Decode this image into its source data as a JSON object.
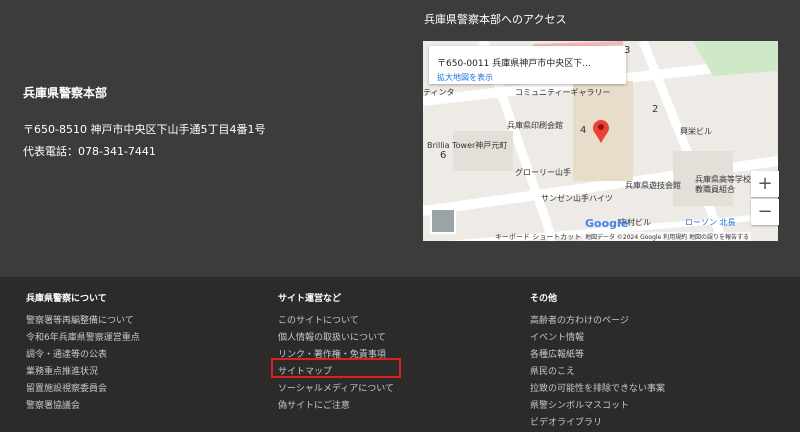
{
  "org": {
    "name": "兵庫県警察本部",
    "address": "〒650-8510 神戸市中央区下山手通5丁目4番1号",
    "tel": "代表電話：078-341-7441"
  },
  "access": {
    "title": "兵庫県警察本部へのアクセス",
    "map_card_address": "〒650-0011 兵庫県神戸市中央区下...",
    "map_card_link": "拡大地図を表示",
    "labels": [
      "コミュニティーギャラリー",
      "兵庫県印刷会館",
      "Brillia Tower神戸元町",
      "グローリー山手",
      "サンゼン山手ハイツ",
      "兵庫県遊技会館",
      "兵庫県高等学校",
      "教職員組合",
      "興栄ビル",
      "中村ビル",
      "ローソン 北長",
      "キーボード ショートカット",
      "ティンタ"
    ],
    "numbers": [
      "4",
      "2",
      "6",
      "3"
    ],
    "zoom_in": "+",
    "zoom_out": "−",
    "footer_attr": "地図データ ©2024 Google   利用規約   地図の誤りを報告する",
    "google": "Google"
  },
  "footer": {
    "col1": {
      "title": "兵庫県警察について",
      "links": [
        "警察署等再編整備について",
        "令和6年兵庫県警察運営重点",
        "調令・通達等の公表",
        "業務重点推進状況",
        "留置施設視察委員会",
        "警察署協議会"
      ]
    },
    "col2": {
      "title": "サイト運営など",
      "links": [
        "このサイトについて",
        "個人情報の取扱いについて",
        "リンク・著作権・免責事項",
        "サイトマップ",
        "ソーシャルメディアについて",
        "偽サイトにご注意"
      ]
    },
    "col3": {
      "title": "その他",
      "links": [
        "高齢者の方わけのページ",
        "イベント情報",
        "各種広報紙等",
        "県民のこえ",
        "拉致の可能性を排除できない事案",
        "県警シンボルマスコット",
        "ビデオライブラリ"
      ]
    }
  }
}
